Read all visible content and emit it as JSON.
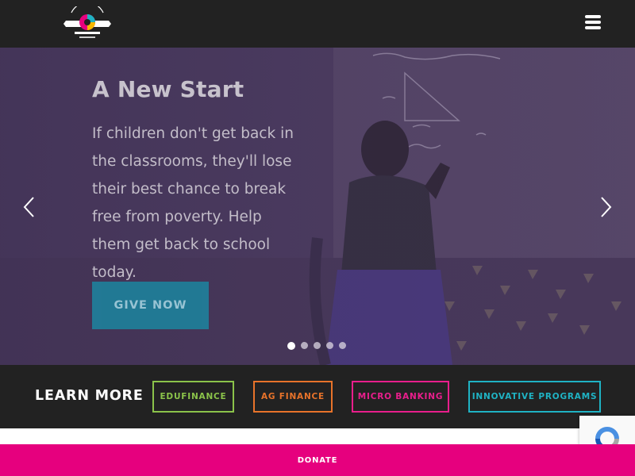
{
  "header": {
    "logo_icon": "opportunity-international-anniversary-logo",
    "menu_icon": "hamburger-menu-icon"
  },
  "hero": {
    "title": "A New Start",
    "text": "If children don't get back in the classrooms, they'll lose their best chance to break free from poverty. Help them get back to school today.",
    "cta_label": "GIVE NOW",
    "prev_icon": "chevron-left-icon",
    "next_icon": "chevron-right-icon",
    "slide_count": 5,
    "active_slide": 1,
    "colors": {
      "cta_bg": "#1f7f9a",
      "overlay": "#5b4770"
    }
  },
  "learn_more": {
    "title": "LEARN MORE",
    "buttons": [
      {
        "label": "EDUFINANCE",
        "color": "#8bc34a"
      },
      {
        "label": "AG FINANCE",
        "color": "#e8732a"
      },
      {
        "label": "MICRO BANKING",
        "color": "#e91e8c"
      },
      {
        "label": "INNOVATIVE PROGRAMS",
        "color": "#1fb3c4"
      }
    ]
  },
  "recaptcha": {
    "icon": "recaptcha-icon"
  },
  "donate": {
    "label": "DONATE",
    "color": "#e6007e"
  }
}
